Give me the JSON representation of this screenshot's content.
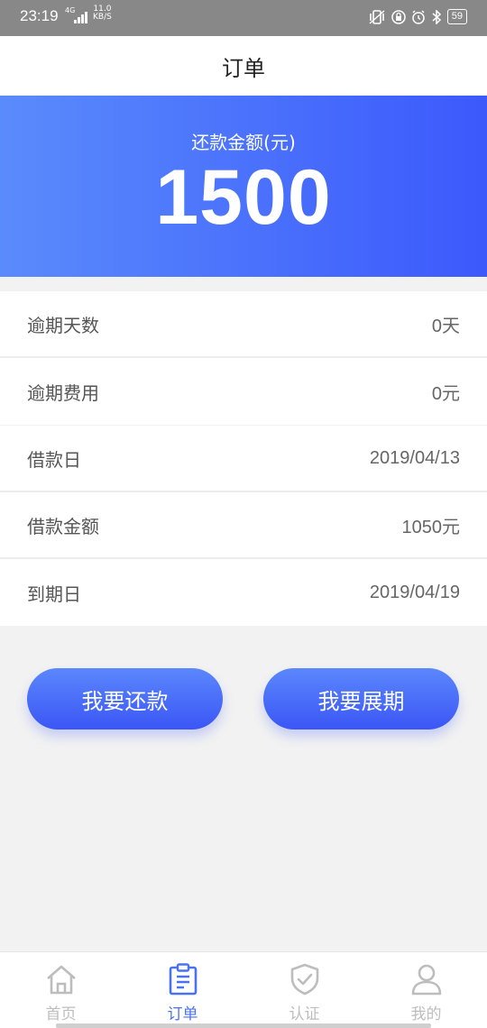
{
  "status_bar": {
    "time": "23:19",
    "network": "4G",
    "speed_value": "11.0",
    "speed_unit": "KB/S",
    "battery": "59"
  },
  "header": {
    "title": "订单"
  },
  "summary": {
    "label": "还款金额(元)",
    "amount": "1500"
  },
  "overdue": [
    {
      "label": "逾期天数",
      "value": "0天"
    },
    {
      "label": "逾期费用",
      "value": "0元"
    }
  ],
  "loan": [
    {
      "label": "借款日",
      "value": "2019/04/13"
    },
    {
      "label": "借款金额",
      "value": "1050元"
    },
    {
      "label": "到期日",
      "value": "2019/04/19"
    }
  ],
  "actions": {
    "repay": "我要还款",
    "extend": "我要展期"
  },
  "tabs": [
    {
      "label": "首页",
      "icon": "home-icon"
    },
    {
      "label": "订单",
      "icon": "order-icon"
    },
    {
      "label": "认证",
      "icon": "shield-check-icon"
    },
    {
      "label": "我的",
      "icon": "user-icon"
    }
  ],
  "colors": {
    "accent": "#4a72f0",
    "banner_start": "#5a8bfc",
    "banner_end": "#3c59fc",
    "inactive": "#bdbdbd"
  }
}
